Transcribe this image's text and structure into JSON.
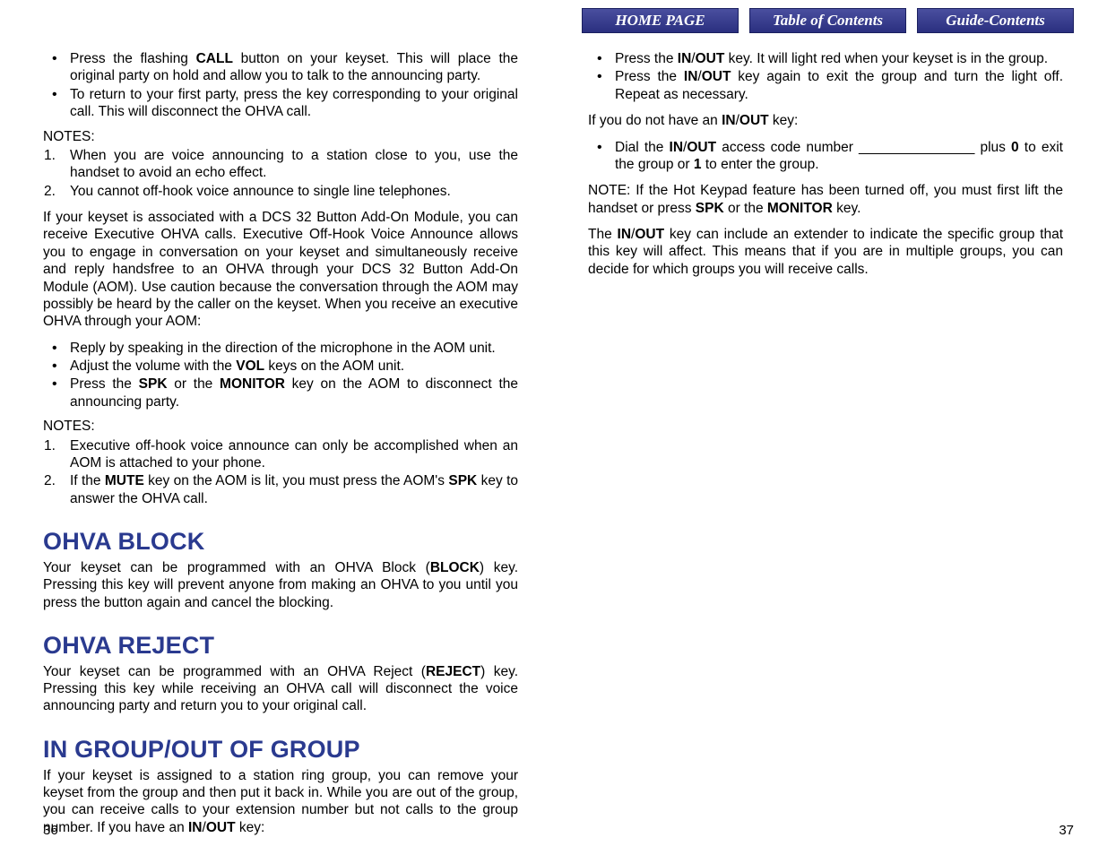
{
  "nav": {
    "home": "HOME PAGE",
    "toc": "Table of Contents",
    "guide": "Guide-Contents"
  },
  "left": {
    "bullets1_0": "Press the flashing <b>CALL</b> button on your keyset. This will place the original party on hold and allow you to talk to the announcing party.",
    "bullets1_1": "To return to your first party, press the key corresponding to your original call. This will disconnect the OHVA call.",
    "notes1_label": "NOTES:",
    "notes1_0": "When you are voice announcing to a station close to you, use the handset to avoid an echo effect.",
    "notes1_1": "You cannot off-hook voice announce to single line telephones.",
    "para1": "If your keyset is associated with a DCS 32 Button Add-On Module, you can receive Executive OHVA calls. Executive Off-Hook Voice Announce allows you to engage in conversation on your keyset and simultaneously receive and reply handsfree to an OHVA through your DCS 32 Button Add-On Module (AOM). Use caution because the conversation through the AOM may possibly be heard by the caller on the keyset. When you receive an executive OHVA through your AOM:",
    "bullets2_0": "Reply by speaking in the direction of the microphone in the AOM unit.",
    "bullets2_1": "Adjust the volume with the <b>VOL</b> keys on the AOM unit.",
    "bullets2_2": "Press the <b>SPK</b> or the <b>MONITOR</b> key on the AOM to disconnect the announcing party.",
    "notes2_label": "NOTES:",
    "notes2_0": "Executive off-hook voice announce can only be accomplished when an AOM is attached to your phone.",
    "notes2_1": "If the <b>MUTE</b> key on the AOM is lit, you must press the AOM's <b>SPK</b> key to answer the OHVA call.",
    "heading1": "OHVA BLOCK",
    "para2": "Your keyset can be programmed with an OHVA Block (<b>BLOCK</b>) key. Pressing this key will prevent anyone from making an OHVA to you until you press the button again and cancel the blocking.",
    "heading2": "OHVA REJECT",
    "para3": "Your keyset can be programmed with an OHVA Reject (<b>REJECT</b>) key. Pressing this key while receiving an OHVA call will disconnect the voice announcing party and return you to your original call.",
    "heading3": "IN GROUP/OUT OF GROUP",
    "para4": "If your keyset is assigned to a station ring group, you can remove your keyset from the group and then put it back in. While you are out of the group, you can receive calls to your extension number but not calls to the group number. If you have an <b>IN</b>/<b>OUT</b> key:",
    "page_num": "36"
  },
  "right": {
    "bullets1_0": "Press the <b>IN</b>/<b>OUT</b> key. It will light red when your keyset is in the group.",
    "bullets1_1": "Press the <b>IN</b>/<b>OUT</b> key again to exit the group and turn the light off. Repeat as necessary.",
    "para1": "If you do not have an <b>IN</b>/<b>OUT</b> key:",
    "bullets2_0": "Dial the <b>IN</b>/<b>OUT</b> access code number _______________ plus <b>0</b> to exit the group or <b>1</b> to enter the group.",
    "para2": "NOTE: If the Hot Keypad feature has been turned off, you must first lift the handset or press <b>SPK</b> or the <b>MONITOR</b> key.",
    "para3": "The <b>IN</b>/<b>OUT</b> key can include an extender to indicate the specific group that this key will affect. This means that if you are in multiple groups, you can decide for which groups you will receive calls.",
    "page_num": "37"
  }
}
